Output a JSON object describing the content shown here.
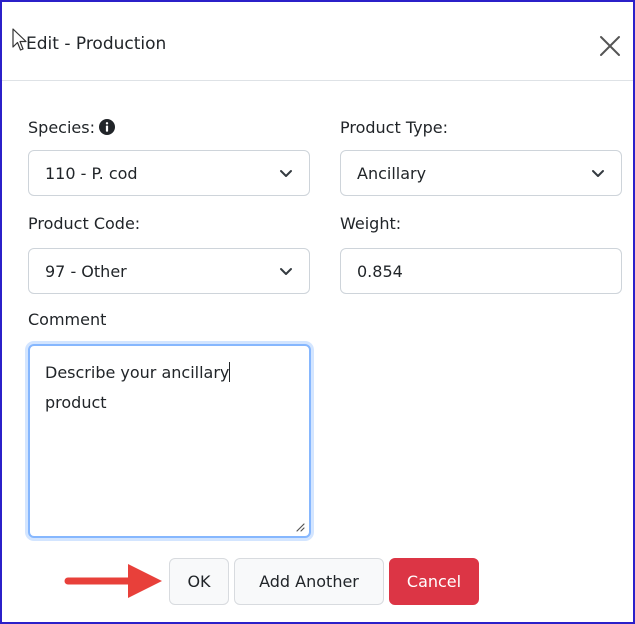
{
  "dialog": {
    "title": "Edit - Production",
    "close_icon": "close-icon"
  },
  "form": {
    "species": {
      "label": "Species:",
      "value": "110 - P. cod",
      "info_icon": "info-circle-icon"
    },
    "product_type": {
      "label": "Product Type:",
      "value": "Ancillary"
    },
    "product_code": {
      "label": "Product Code:",
      "value": "97 - Other"
    },
    "weight": {
      "label": "Weight:",
      "value": "0.854"
    },
    "comment": {
      "label": "Comment",
      "value": "Describe your ancillary product"
    }
  },
  "footer": {
    "ok_label": "OK",
    "add_another_label": "Add Another",
    "cancel_label": "Cancel"
  },
  "colors": {
    "dialog_border": "#2b20c9",
    "danger": "#dc3545",
    "focus": "#86b7fe",
    "arrow": "#e8403a"
  }
}
